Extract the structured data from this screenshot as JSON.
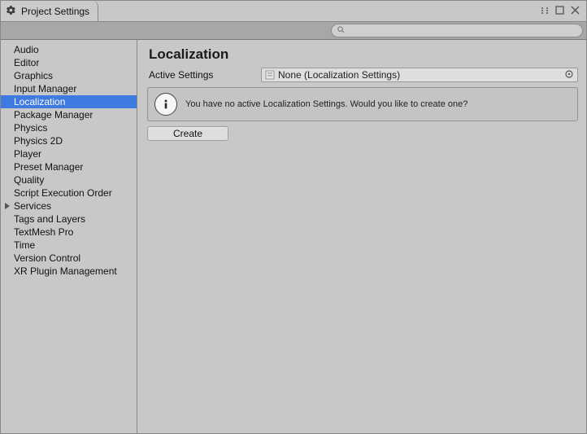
{
  "window": {
    "title": "Project Settings"
  },
  "search": {
    "value": "",
    "placeholder": ""
  },
  "sidebar": {
    "items": [
      {
        "label": "Audio",
        "selected": false,
        "hasChildren": false
      },
      {
        "label": "Editor",
        "selected": false,
        "hasChildren": false
      },
      {
        "label": "Graphics",
        "selected": false,
        "hasChildren": false
      },
      {
        "label": "Input Manager",
        "selected": false,
        "hasChildren": false
      },
      {
        "label": "Localization",
        "selected": true,
        "hasChildren": false
      },
      {
        "label": "Package Manager",
        "selected": false,
        "hasChildren": false
      },
      {
        "label": "Physics",
        "selected": false,
        "hasChildren": false
      },
      {
        "label": "Physics 2D",
        "selected": false,
        "hasChildren": false
      },
      {
        "label": "Player",
        "selected": false,
        "hasChildren": false
      },
      {
        "label": "Preset Manager",
        "selected": false,
        "hasChildren": false
      },
      {
        "label": "Quality",
        "selected": false,
        "hasChildren": false
      },
      {
        "label": "Script Execution Order",
        "selected": false,
        "hasChildren": false
      },
      {
        "label": "Services",
        "selected": false,
        "hasChildren": true
      },
      {
        "label": "Tags and Layers",
        "selected": false,
        "hasChildren": false
      },
      {
        "label": "TextMesh Pro",
        "selected": false,
        "hasChildren": false
      },
      {
        "label": "Time",
        "selected": false,
        "hasChildren": false
      },
      {
        "label": "Version Control",
        "selected": false,
        "hasChildren": false
      },
      {
        "label": "XR Plugin Management",
        "selected": false,
        "hasChildren": false
      }
    ]
  },
  "panel": {
    "title": "Localization",
    "active_settings_label": "Active Settings",
    "active_settings_value": "None (Localization Settings)",
    "help_text": "You have no active Localization Settings. Would you like to create one?",
    "create_button": "Create"
  }
}
